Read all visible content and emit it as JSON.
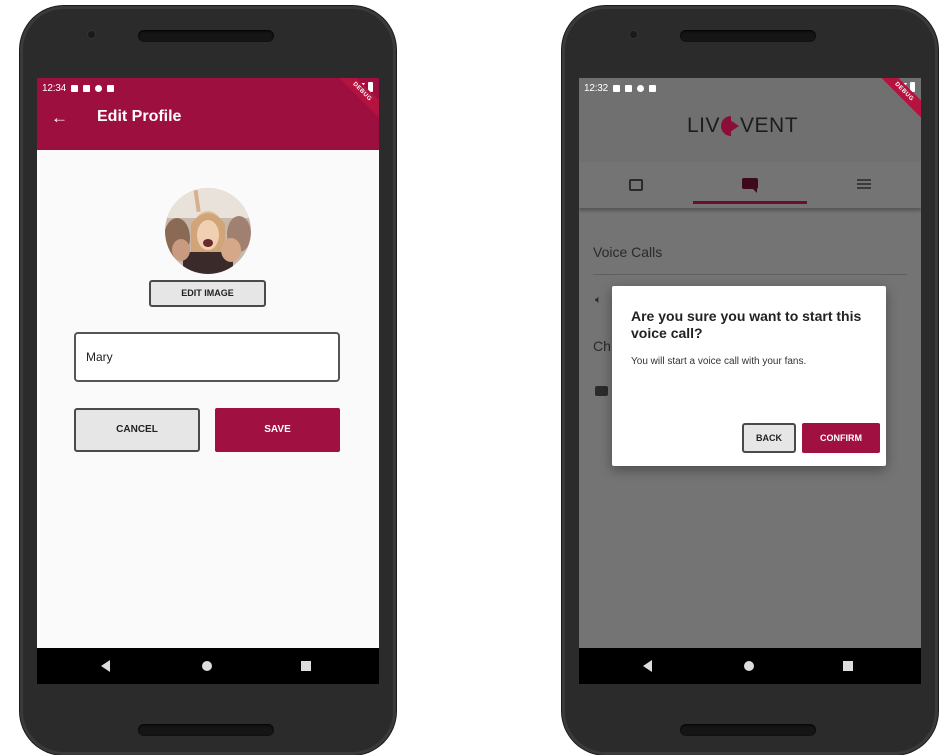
{
  "left_phone": {
    "status": {
      "time": "12:34"
    },
    "app_bar": {
      "title": "Edit Profile"
    },
    "edit_image_label": "EDIT IMAGE",
    "name_input_value": "Mary",
    "cancel_label": "CANCEL",
    "save_label": "SAVE",
    "debug_banner": "DEBUG"
  },
  "right_phone": {
    "status": {
      "time": "12:32"
    },
    "logo": {
      "prefix": "LIV",
      "suffix": "VENT"
    },
    "section_title": "Voice Calls",
    "chat_heading_partial": "Ch",
    "dialog": {
      "title": "Are you sure you want to start this voice call?",
      "body": "You will start a voice call with your fans.",
      "back_label": "BACK",
      "confirm_label": "CONFIRM"
    },
    "debug_banner": "DEBUG"
  },
  "colors": {
    "brand": "#9c0f3f",
    "button_primary": "#a01040",
    "button_secondary": "#e6e6e6",
    "phone_body": "#2b2b2b"
  },
  "icons": [
    "back-arrow-icon",
    "photo-icon",
    "chat-icon",
    "menu-icon",
    "volume-icon",
    "wifi-icon",
    "battery-icon"
  ]
}
